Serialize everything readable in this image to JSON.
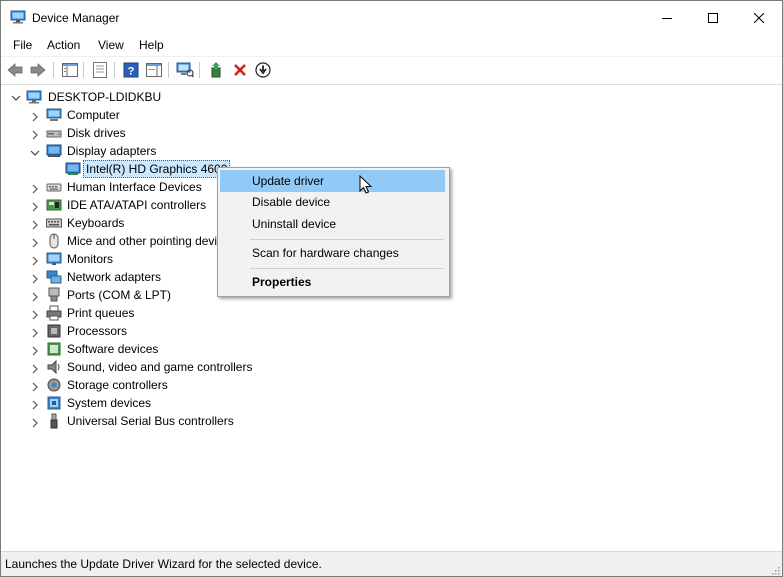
{
  "window": {
    "title": "Device Manager"
  },
  "menu": [
    "File",
    "Action",
    "View",
    "Help"
  ],
  "toolbar_icons": [
    "back-icon",
    "forward-icon",
    "console-tree-icon",
    "properties-icon",
    "help-icon",
    "action-pane-icon",
    "scan-hardware-icon",
    "update-driver-icon",
    "uninstall-icon",
    "disable-icon"
  ],
  "tree": {
    "root": "DESKTOP-LDIDKBU",
    "categories": [
      {
        "label": "Computer",
        "icon": "computer-icon",
        "expanded": false
      },
      {
        "label": "Disk drives",
        "icon": "disk-drive-icon",
        "expanded": false
      },
      {
        "label": "Display adapters",
        "icon": "display-adapter-icon",
        "expanded": true
      },
      {
        "label": "Intel(R) HD Graphics 4600",
        "icon": "display-adapter-icon",
        "child": true,
        "selected": true
      },
      {
        "label": "Human Interface Devices",
        "icon": "hid-icon",
        "expanded": false
      },
      {
        "label": "IDE ATA/ATAPI controllers",
        "icon": "ide-controller-icon",
        "expanded": false
      },
      {
        "label": "Keyboards",
        "icon": "keyboard-icon",
        "expanded": false
      },
      {
        "label": "Mice and other pointing devices",
        "icon": "mouse-icon",
        "expanded": false
      },
      {
        "label": "Monitors",
        "icon": "monitor-icon",
        "expanded": false
      },
      {
        "label": "Network adapters",
        "icon": "network-adapter-icon",
        "expanded": false
      },
      {
        "label": "Ports (COM & LPT)",
        "icon": "port-icon",
        "expanded": false
      },
      {
        "label": "Print queues",
        "icon": "printer-icon",
        "expanded": false
      },
      {
        "label": "Processors",
        "icon": "processor-icon",
        "expanded": false
      },
      {
        "label": "Software devices",
        "icon": "software-device-icon",
        "expanded": false
      },
      {
        "label": "Sound, video and game controllers",
        "icon": "speaker-icon",
        "expanded": false
      },
      {
        "label": "Storage controllers",
        "icon": "storage-controller-icon",
        "expanded": false
      },
      {
        "label": "System devices",
        "icon": "system-device-icon",
        "expanded": false
      },
      {
        "label": "Universal Serial Bus controllers",
        "icon": "usb-icon",
        "expanded": false
      }
    ]
  },
  "context_menu": {
    "update_driver": "Update driver",
    "disable_device": "Disable device",
    "uninstall_device": "Uninstall device",
    "scan_hardware": "Scan for hardware changes",
    "properties": "Properties"
  },
  "status": {
    "text": "Launches the Update Driver Wizard for the selected device."
  },
  "colors": {
    "selection": "#cce8ff",
    "menu_highlight": "#91c9f7",
    "status_bg": "#f0f0f0"
  }
}
